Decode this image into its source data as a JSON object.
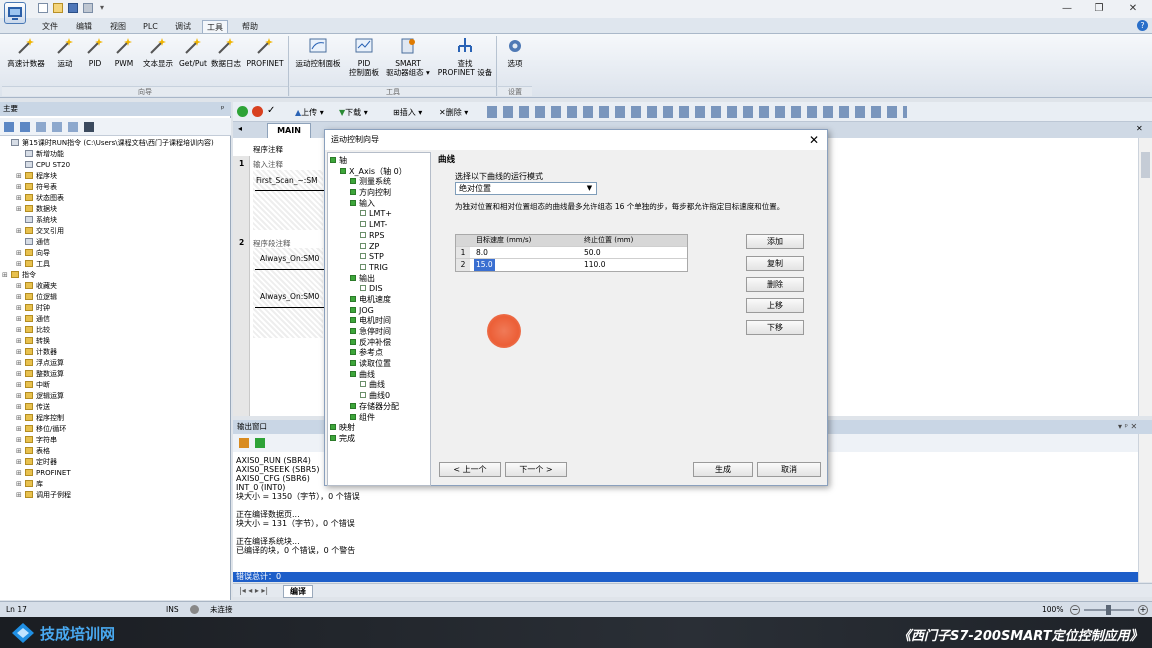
{
  "app": {
    "title_icon": "step7-microwin-logo",
    "quick_access_icons": [
      "new-file-icon",
      "open-folder-icon",
      "save-icon",
      "print-icon"
    ],
    "window_controls": [
      "—",
      "❐",
      "✕"
    ],
    "help_icon": "?"
  },
  "menu": [
    "文件",
    "编辑",
    "视图",
    "PLC",
    "调试",
    "工具",
    "帮助"
  ],
  "active_menu": "工具",
  "ribbon": {
    "groups": [
      {
        "label": "向导",
        "buttons": [
          "高速计数器",
          "运动",
          "PID",
          "PWM",
          "文本显示",
          "Get/Put",
          "数据日志",
          "PROFINET"
        ]
      },
      {
        "label": "工具",
        "buttons": [
          "运动控制面板",
          "PID\n控制面板",
          "SMART\n驱动器组态 ▾",
          "查找\nPROFINET 设备"
        ]
      },
      {
        "label": "设置",
        "buttons": [
          "选项"
        ]
      }
    ]
  },
  "left_panel": {
    "title": "主要",
    "tree": [
      {
        "text": "第15课时RUN指令 (C:\\Users\\课程文档\\西门子课程培训内容)",
        "level": 0,
        "kind": "leaf"
      },
      {
        "text": "新增功能",
        "level": 1,
        "kind": "leaf"
      },
      {
        "text": "CPU ST20",
        "level": 1,
        "kind": "leaf"
      },
      {
        "text": "程序块",
        "level": 1,
        "kind": "folder"
      },
      {
        "text": "符号表",
        "level": 1,
        "kind": "folder"
      },
      {
        "text": "状态图表",
        "level": 1,
        "kind": "folder"
      },
      {
        "text": "数据块",
        "level": 1,
        "kind": "folder"
      },
      {
        "text": "系统块",
        "level": 1,
        "kind": "leaf"
      },
      {
        "text": "交叉引用",
        "level": 1,
        "kind": "folder"
      },
      {
        "text": "通信",
        "level": 1,
        "kind": "leaf"
      },
      {
        "text": "向导",
        "level": 1,
        "kind": "folder"
      },
      {
        "text": "工具",
        "level": 1,
        "kind": "folder"
      },
      {
        "text": "指令",
        "level": 0,
        "kind": "folder"
      },
      {
        "text": "收藏夹",
        "level": 1,
        "kind": "folder"
      },
      {
        "text": "位逻辑",
        "level": 1,
        "kind": "folder"
      },
      {
        "text": "时钟",
        "level": 1,
        "kind": "folder"
      },
      {
        "text": "通信",
        "level": 1,
        "kind": "folder"
      },
      {
        "text": "比较",
        "level": 1,
        "kind": "folder"
      },
      {
        "text": "转换",
        "level": 1,
        "kind": "folder"
      },
      {
        "text": "计数器",
        "level": 1,
        "kind": "folder"
      },
      {
        "text": "浮点运算",
        "level": 1,
        "kind": "folder"
      },
      {
        "text": "整数运算",
        "level": 1,
        "kind": "folder"
      },
      {
        "text": "中断",
        "level": 1,
        "kind": "folder"
      },
      {
        "text": "逻辑运算",
        "level": 1,
        "kind": "folder"
      },
      {
        "text": "传送",
        "level": 1,
        "kind": "folder"
      },
      {
        "text": "程序控制",
        "level": 1,
        "kind": "folder"
      },
      {
        "text": "移位/循环",
        "level": 1,
        "kind": "folder"
      },
      {
        "text": "字符串",
        "level": 1,
        "kind": "folder"
      },
      {
        "text": "表格",
        "level": 1,
        "kind": "folder"
      },
      {
        "text": "定时器",
        "level": 1,
        "kind": "folder"
      },
      {
        "text": "PROFINET",
        "level": 1,
        "kind": "folder"
      },
      {
        "text": "库",
        "level": 1,
        "kind": "folder"
      },
      {
        "text": "调用子例程",
        "level": 1,
        "kind": "folder"
      }
    ]
  },
  "editor_toolbar": {
    "upload": "上传",
    "download": "下载",
    "insert": "插入",
    "delete": "删除"
  },
  "editor": {
    "tab": "MAIN",
    "block_comment": "程序注释",
    "networks": [
      {
        "num": "1",
        "comment": "输入注释",
        "contact": "First_Scan_~:SM"
      },
      {
        "num": "2",
        "comment": "程序段注释",
        "contact": "Always_On:SM0",
        "contact2": "Always_On:SM0"
      }
    ]
  },
  "output": {
    "title": "输出窗口",
    "lines": [
      "AXIS0_RUN (SBR4)",
      "AXIS0_RSEEK (SBR5)",
      "AXIS0_CFG (SBR6)",
      "INT_0 (INT0)",
      "块大小 = 1350（字节），0 个错误",
      "",
      "正在编译数据页...",
      "块大小 = 131（字节），0 个错误",
      "",
      "正在编译系统块...",
      "已编译的块，0 个错误，0 个警告"
    ],
    "selected_line": "错误总计：0",
    "tab": "编译"
  },
  "status": {
    "position": "Ln 17",
    "mode": "INS",
    "connection": "未连接",
    "zoom": "100%"
  },
  "banner": {
    "brand": "技成培训网",
    "subtitle": "《西门子S7-200SMART定位控制应用》"
  },
  "dialog": {
    "title": "运动控制向导",
    "wizard_tree": [
      {
        "text": "轴",
        "level": 0
      },
      {
        "text": "X_Axis（轴 0）",
        "level": 1
      },
      {
        "text": "测量系统",
        "level": 2
      },
      {
        "text": "方向控制",
        "level": 2
      },
      {
        "text": "输入",
        "level": 2
      },
      {
        "text": "LMT+",
        "level": 3
      },
      {
        "text": "LMT-",
        "level": 3
      },
      {
        "text": "RPS",
        "level": 3
      },
      {
        "text": "ZP",
        "level": 3
      },
      {
        "text": "STP",
        "level": 3
      },
      {
        "text": "TRIG",
        "level": 3
      },
      {
        "text": "输出",
        "level": 2
      },
      {
        "text": "DIS",
        "level": 3
      },
      {
        "text": "电机速度",
        "level": 2
      },
      {
        "text": "JOG",
        "level": 2
      },
      {
        "text": "电机时间",
        "level": 2
      },
      {
        "text": "急停时间",
        "level": 2
      },
      {
        "text": "反冲补偿",
        "level": 2
      },
      {
        "text": "参考点",
        "level": 2
      },
      {
        "text": "读取位置",
        "level": 2
      },
      {
        "text": "曲线",
        "level": 2
      },
      {
        "text": "曲线",
        "level": 3
      },
      {
        "text": "曲线0",
        "level": 3
      },
      {
        "text": "存储器分配",
        "level": 2
      },
      {
        "text": "组件",
        "level": 2
      },
      {
        "text": "映射",
        "level": 0
      },
      {
        "text": "完成",
        "level": 0
      }
    ],
    "section_title": "曲线",
    "mode_label": "选择以下曲线的运行模式",
    "mode_value": "绝对位置",
    "description": "为独对位置和相对位置组态的曲线最多允许组态 16 个单独的步，每步都允许指定目标速度和位置。",
    "table": {
      "headers": [
        "目标速度 (mm/s)",
        "终止位置 (mm)"
      ],
      "rows": [
        {
          "index": "1",
          "speed": "8.0",
          "position": "50.0"
        },
        {
          "index": "2",
          "speed": "15.0",
          "position": "110.0"
        }
      ]
    },
    "side_buttons": [
      "添加",
      "复制",
      "删除",
      "上移",
      "下移"
    ],
    "prev": "< 上一个",
    "next": "下一个 >",
    "generate": "生成",
    "cancel": "取消"
  }
}
